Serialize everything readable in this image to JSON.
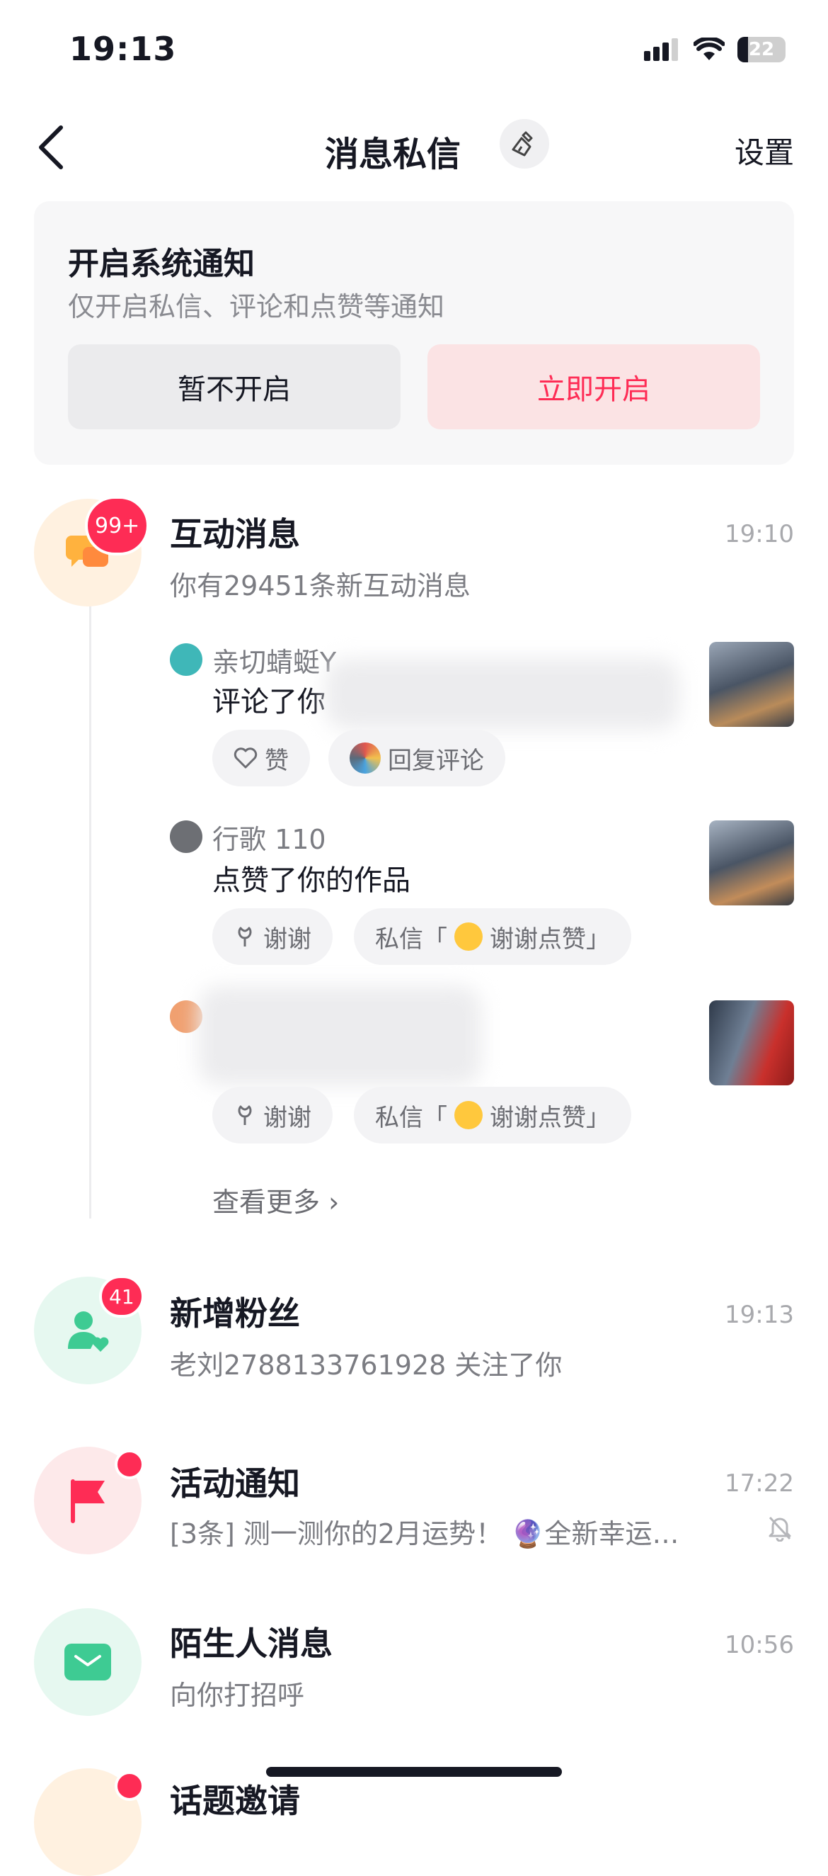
{
  "status_bar": {
    "time": "19:13",
    "battery": "22"
  },
  "nav": {
    "title": "消息私信",
    "settings_label": "设置"
  },
  "notify_banner": {
    "title": "开启系统通知",
    "subtitle": "仅开启私信、评论和点赞等通知",
    "btn_later": "暂不开启",
    "btn_enable": "立即开启"
  },
  "interaction": {
    "title": "互动消息",
    "badge": "99+",
    "subtitle": "你有29451条新互动消息",
    "time": "19:10",
    "items": [
      {
        "user": "亲切蜻蜓Y",
        "action": "评论了你",
        "chips": [
          "赞",
          "回复评论"
        ]
      },
      {
        "user": "行歌 110",
        "action": "点赞了你的作品",
        "chips": [
          "谢谢",
          "私信「",
          "谢谢点赞」"
        ]
      },
      {
        "user": "",
        "action": "",
        "chips": [
          "谢谢",
          "私信「",
          "谢谢点赞」"
        ]
      }
    ],
    "more_label": "查看更多 ›"
  },
  "followers": {
    "title": "新增粉丝",
    "badge": "41",
    "subtitle": "老刘2788133761928 关注了你",
    "time": "19:13"
  },
  "activity": {
    "title": "活动通知",
    "subtitle": "[3条] 测一测你的2月运势！ 🔮全新幸运…",
    "time": "17:22"
  },
  "stranger": {
    "title": "陌生人消息",
    "subtitle": "向你打招呼",
    "time": "10:56"
  },
  "topic": {
    "title": "话题邀请"
  },
  "colors": {
    "accent": "#fe2c55",
    "green": "#3ecb93",
    "orange": "#ffb23e"
  }
}
